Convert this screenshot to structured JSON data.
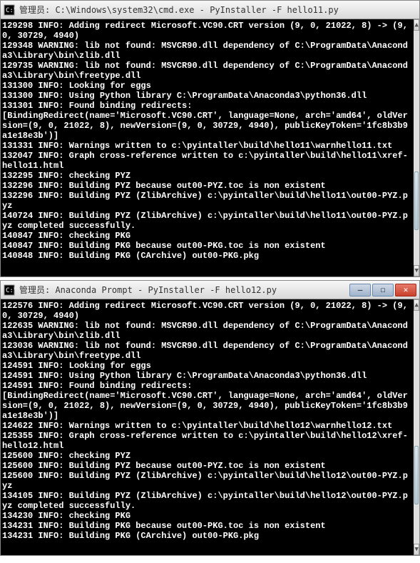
{
  "window1": {
    "title": "管理员: C:\\Windows\\system32\\cmd.exe - PyInstaller  -F hello11.py",
    "icon": "cmd-icon",
    "lines": [
      "129298 INFO: Adding redirect Microsoft.VC90.CRT version (9, 0, 21022, 8) -> (9, 0, 30729, 4940)",
      "129348 WARNING: lib not found: MSVCR90.dll dependency of C:\\ProgramData\\Anaconda3\\Library\\bin\\zlib.dll",
      "129735 WARNING: lib not found: MSVCR90.dll dependency of C:\\ProgramData\\Anaconda3\\Library\\bin\\freetype.dll",
      "131300 INFO: Looking for eggs",
      "131300 INFO: Using Python library C:\\ProgramData\\Anaconda3\\python36.dll",
      "131301 INFO: Found binding redirects:",
      "[BindingRedirect(name='Microsoft.VC90.CRT', language=None, arch='amd64', oldVersion=(9, 0, 21022, 8), newVersion=(9, 0, 30729, 4940), publicKeyToken='1fc8b3b9a1e18e3b')]",
      "131331 INFO: Warnings written to c:\\pyintaller\\build\\hello11\\warnhello11.txt",
      "132047 INFO: Graph cross-reference written to c:\\pyintaller\\build\\hello11\\xref-hello11.html",
      "132295 INFO: checking PYZ",
      "132296 INFO: Building PYZ because out00-PYZ.toc is non existent",
      "132296 INFO: Building PYZ (ZlibArchive) c:\\pyintaller\\build\\hello11\\out00-PYZ.pyz",
      "140724 INFO: Building PYZ (ZlibArchive) c:\\pyintaller\\build\\hello11\\out00-PYZ.pyz completed successfully.",
      "140847 INFO: checking PKG",
      "140847 INFO: Building PKG because out00-PKG.toc is non existent",
      "140848 INFO: Building PKG (CArchive) out00-PKG.pkg"
    ]
  },
  "window2": {
    "title": "管理员: Anaconda Prompt - PyInstaller  -F hello12.py",
    "icon": "cmd-icon",
    "lines": [
      "122576 INFO: Adding redirect Microsoft.VC90.CRT version (9, 0, 21022, 8) -> (9, 0, 30729, 4940)",
      "122635 WARNING: lib not found: MSVCR90.dll dependency of C:\\ProgramData\\Anaconda3\\Library\\bin\\zlib.dll",
      "123036 WARNING: lib not found: MSVCR90.dll dependency of C:\\ProgramData\\Anaconda3\\Library\\bin\\freetype.dll",
      "124591 INFO: Looking for eggs",
      "124591 INFO: Using Python library C:\\ProgramData\\Anaconda3\\python36.dll",
      "124591 INFO: Found binding redirects:",
      "[BindingRedirect(name='Microsoft.VC90.CRT', language=None, arch='amd64', oldVersion=(9, 0, 21022, 8), newVersion=(9, 0, 30729, 4940), publicKeyToken='1fc8b3b9a1e18e3b')]",
      "124622 INFO: Warnings written to c:\\pyintaller\\build\\hello12\\warnhello12.txt",
      "125355 INFO: Graph cross-reference written to c:\\pyintaller\\build\\hello12\\xref-hello12.html",
      "125600 INFO: checking PYZ",
      "125600 INFO: Building PYZ because out00-PYZ.toc is non existent",
      "125600 INFO: Building PYZ (ZlibArchive) c:\\pyintaller\\build\\hello12\\out00-PYZ.pyz",
      "134105 INFO: Building PYZ (ZlibArchive) c:\\pyintaller\\build\\hello12\\out00-PYZ.pyz completed successfully.",
      "134230 INFO: checking PKG",
      "134231 INFO: Building PKG because out00-PKG.toc is non existent",
      "134231 INFO: Building PKG (CArchive) out00-PKG.pkg"
    ]
  },
  "controls": {
    "min": "—",
    "max": "☐",
    "close": "✕"
  }
}
